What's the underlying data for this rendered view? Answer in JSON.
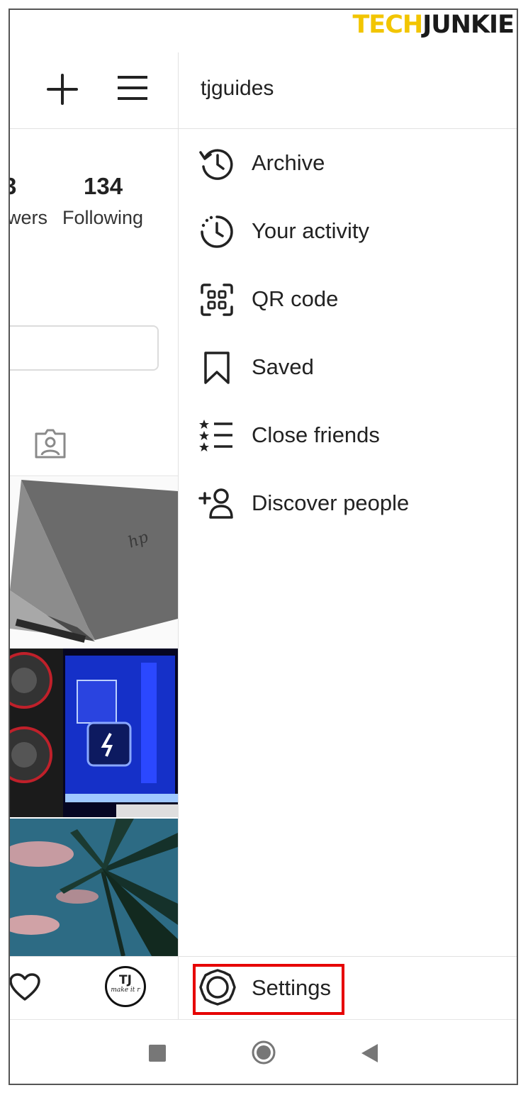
{
  "watermark": {
    "part1": "TECH",
    "part2": "JUNKIE"
  },
  "profile": {
    "stats": [
      {
        "value": "3",
        "label": "wers"
      },
      {
        "value": "134",
        "label": "Following"
      }
    ],
    "posts": [
      {
        "alt": "laptop"
      },
      {
        "alt": "pc-build"
      },
      {
        "alt": "palm-tree"
      }
    ]
  },
  "drawer": {
    "username": "tjguides",
    "items": [
      {
        "label": "Archive",
        "icon": "archive-icon"
      },
      {
        "label": "Your activity",
        "icon": "activity-icon"
      },
      {
        "label": "QR code",
        "icon": "qr-code-icon"
      },
      {
        "label": "Saved",
        "icon": "bookmark-icon"
      },
      {
        "label": "Close friends",
        "icon": "close-friends-icon"
      },
      {
        "label": "Discover people",
        "icon": "add-person-icon"
      }
    ],
    "settings_label": "Settings"
  },
  "avatar": {
    "initials": "TJ",
    "subtitle": "make it r"
  },
  "colors": {
    "highlight": "#e60000",
    "brand_yellow": "#f2c500"
  }
}
